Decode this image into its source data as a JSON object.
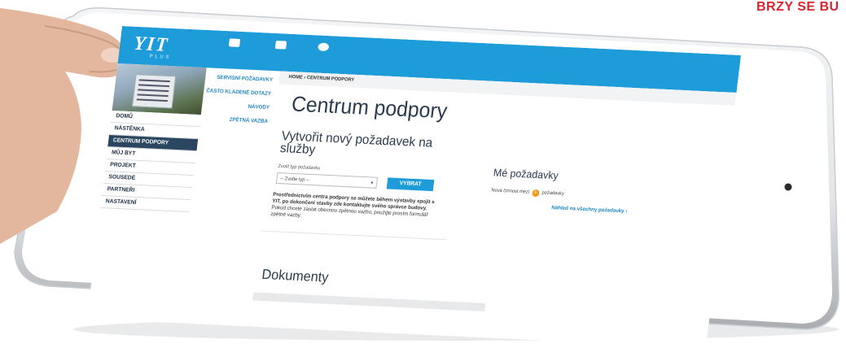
{
  "corner_text": "BRZY SE BU",
  "logo": {
    "name": "YIT",
    "sub": "PLUS"
  },
  "breadcrumb": {
    "home": "HOME",
    "sep": "›",
    "current": "CENTRUM PODPORY"
  },
  "sidebar": {
    "items": [
      {
        "label": "DOMŮ"
      },
      {
        "label": "NÁSTĚNKA"
      },
      {
        "label": "CENTRUM PODPORY"
      },
      {
        "label": "MŮJ BYT"
      },
      {
        "label": "PROJEKT"
      },
      {
        "label": "SOUSEDÉ"
      },
      {
        "label": "PARTNEŘI"
      },
      {
        "label": "NASTAVENÍ"
      }
    ]
  },
  "submenu": {
    "items": [
      {
        "label": "SERVISNÍ POŽADAVKY"
      },
      {
        "label": "ČASTO KLADENÉ DOTAZY"
      },
      {
        "label": "NÁVODY"
      },
      {
        "label": "ZPĚTNÁ VAZBA"
      }
    ]
  },
  "main": {
    "title": "Centrum podpory",
    "request_title": "Vytvořit nový požadavek na služby",
    "select_label": "Zvolit typ požadavku",
    "select_value": "-- Zvolte typ --",
    "button": "VYBRAT",
    "desc_bold": "Prostřednictvím centra podpory se můžete během výstavby spojit s YIT, po dokončení stavby zde kontaktujte svého správce budovy.",
    "desc_rest": "Pokud chcete zaslat obecnou zpětnou vazbu, použijte prosím formulář zpětné vazby.",
    "docs_title": "Dokumenty"
  },
  "my_requests": {
    "title": "Mé požadavky",
    "note_prefix": "Nová činnost mezi",
    "badge": "0",
    "note_suffix": "požadavky",
    "link": "Náhled na všechny požadavky ›"
  },
  "colors": {
    "accent": "#1e9bd9",
    "sidebar_active": "#2b4660",
    "corner": "#d7262e"
  }
}
